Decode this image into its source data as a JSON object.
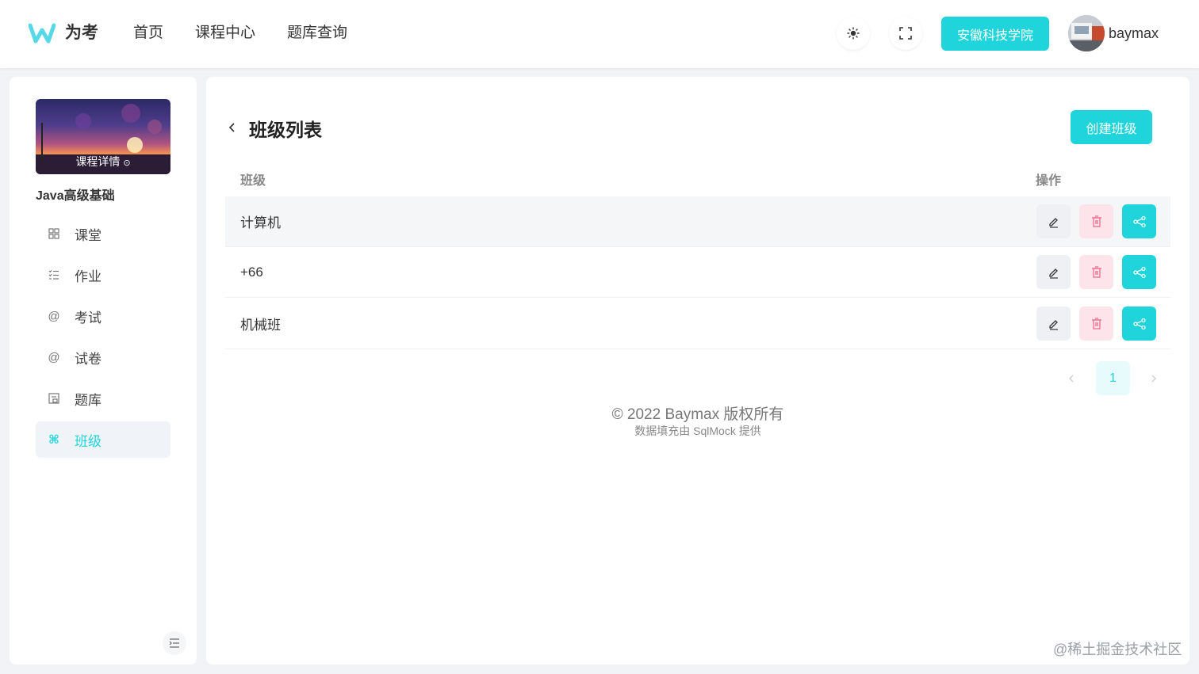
{
  "header": {
    "brand": "为考",
    "nav": [
      "首页",
      "课程中心",
      "题库查询"
    ],
    "school_button": "安徽科技学院",
    "username": "baymax",
    "theme_icon": "sun-icon",
    "fullscreen_icon": "fullscreen-icon"
  },
  "sidebar": {
    "cover_label": "课程详情",
    "course_title": "Java高级基础",
    "items": [
      {
        "label": "课堂",
        "icon": "grid-icon"
      },
      {
        "label": "作业",
        "icon": "checklist-icon"
      },
      {
        "label": "考试",
        "icon": "at-icon"
      },
      {
        "label": "试卷",
        "icon": "at-icon"
      },
      {
        "label": "题库",
        "icon": "question-bank-icon"
      },
      {
        "label": "班级",
        "icon": "command-icon"
      }
    ],
    "active_index": 5
  },
  "main": {
    "title": "班级列表",
    "create_button": "创建班级",
    "columns": [
      "班级",
      "操作"
    ],
    "rows": [
      "计算机",
      "+66",
      "机械班"
    ],
    "pagination": {
      "current": "1"
    }
  },
  "footer": {
    "line1": "© 2022 Baymax 版权所有",
    "line2": "数据填充由 SqlMock 提供"
  },
  "watermark": "@稀土掘金技术社区",
  "colors": {
    "accent": "#1fd5db",
    "danger_bg": "#fde4ea",
    "danger": "#f06b8e"
  }
}
